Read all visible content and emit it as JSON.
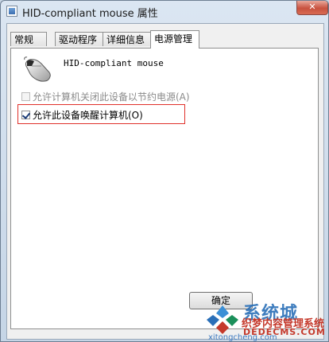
{
  "window": {
    "title": "HID-compliant mouse 属性",
    "close_glyph": "✕"
  },
  "tabs": [
    {
      "label": "常规",
      "active": false
    },
    {
      "label": "驱动程序",
      "active": false
    },
    {
      "label": "详细信息",
      "active": false
    },
    {
      "label": "电源管理",
      "active": true
    }
  ],
  "device": {
    "icon": "mouse-icon",
    "name": "HID-compliant mouse"
  },
  "options": [
    {
      "label": "允许计算机关闭此设备以节约电源(A)",
      "checked": false,
      "enabled": false
    },
    {
      "label": "允许此设备唤醒计算机(O)",
      "checked": true,
      "enabled": true
    }
  ],
  "buttons": {
    "ok_label": "确定"
  },
  "watermark": {
    "brand_big": "系统城",
    "brand_cn": "织梦内容管理系统",
    "brand_domain": "DEDECMS.COM",
    "url": "xitongcheng.com"
  },
  "colors": {
    "highlight": "#e0302a",
    "watermark_red": "#c53a2c",
    "watermark_blue": "#2a6fb8"
  }
}
